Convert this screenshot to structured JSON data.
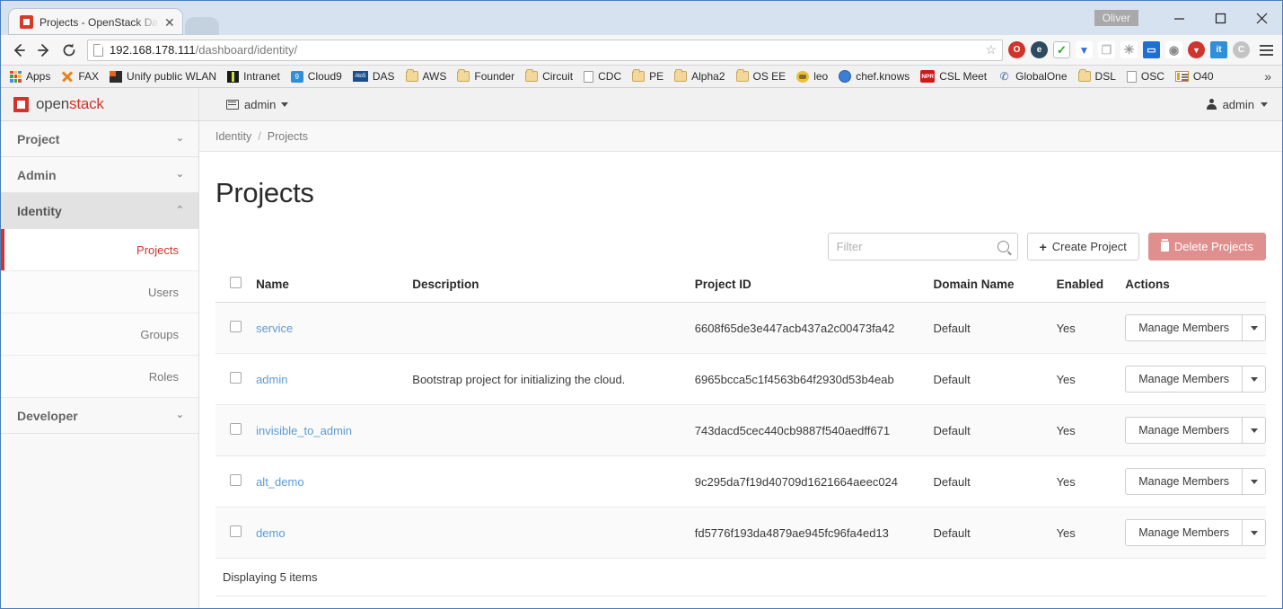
{
  "browser": {
    "tab": {
      "title": "Projects - OpenStack Dash",
      "close_label": "✕",
      "favicon": "openstack-favicon"
    },
    "window": {
      "user_badge": "Oliver",
      "minimize_label": "minimize",
      "maximize_label": "maximize",
      "close_label": "close"
    },
    "nav": {
      "back_label": "←",
      "forward_label": "→",
      "reload_label": "↻",
      "url_host": "192.168.178.111",
      "url_path": "/dashboard/identity/",
      "star_label": "☆",
      "menu_label": "menu"
    },
    "extensions": [
      {
        "name": "opera-icon",
        "glyph": "O",
        "bg": "#d0342c",
        "fg": "#ffffff"
      },
      {
        "name": "edge-icon",
        "glyph": "e",
        "bg": "#2d4a5e",
        "fg": "#ffffff"
      },
      {
        "name": "checkmark-icon",
        "glyph": "✓",
        "bg": "#ffffff",
        "fg": "#2aa62a"
      },
      {
        "name": "diamond-icon",
        "glyph": "▼",
        "bg": "#ffffff",
        "fg": "#3a6fd8"
      },
      {
        "name": "copy-pages-icon",
        "glyph": "❐",
        "bg": "#ffffff",
        "fg": "#b8b8b8"
      },
      {
        "name": "globe-icon",
        "glyph": "●",
        "bg": "#ffffff",
        "fg": "#9a9a9a"
      },
      {
        "name": "window-icon",
        "glyph": "▭",
        "bg": "#1f6fd0",
        "fg": "#ffffff"
      },
      {
        "name": "film-reel-icon",
        "glyph": "◉",
        "bg": "#ffffff",
        "fg": "#8a8a8a"
      },
      {
        "name": "download-icon",
        "glyph": "▼",
        "bg": "#d0342c",
        "fg": "#ffffff"
      },
      {
        "name": "it-icon",
        "glyph": "it",
        "bg": "#2f8fd8",
        "fg": "#ffffff"
      },
      {
        "name": "copy-c-icon",
        "glyph": "C",
        "bg": "#c4c4c4",
        "fg": "#ffffff"
      }
    ],
    "bookmarks": [
      {
        "label": "Apps",
        "icon": "apps-grid-icon"
      },
      {
        "label": "FAX",
        "icon": "fax-x-icon"
      },
      {
        "label": "Unify public WLAN",
        "icon": "unify-icon"
      },
      {
        "label": "Intranet",
        "icon": "intranet-icon"
      },
      {
        "label": "Cloud9",
        "icon": "cloud9-icon"
      },
      {
        "label": "DAS",
        "icon": "das-icon"
      },
      {
        "label": "AWS",
        "icon": "folder-icon"
      },
      {
        "label": "Founder",
        "icon": "folder-icon"
      },
      {
        "label": "Circuit",
        "icon": "folder-icon"
      },
      {
        "label": "CDC",
        "icon": "doc-icon"
      },
      {
        "label": "PE",
        "icon": "folder-icon"
      },
      {
        "label": "Alpha2",
        "icon": "folder-icon"
      },
      {
        "label": "OS EE",
        "icon": "folder-icon"
      },
      {
        "label": "leo",
        "icon": "leo-icon"
      },
      {
        "label": "chef.knows",
        "icon": "chef-icon"
      },
      {
        "label": "CSL Meet",
        "icon": "npr-icon"
      },
      {
        "label": "GlobalOne",
        "icon": "globalone-icon"
      },
      {
        "label": "DSL",
        "icon": "folder-icon"
      },
      {
        "label": "OSC",
        "icon": "doc-icon"
      },
      {
        "label": "O40",
        "icon": "o40-icon"
      }
    ],
    "bookmarks_overflow_label": "»"
  },
  "dashboard": {
    "brand": {
      "word1": "open",
      "word2": "stack",
      "logo": "openstack-logo-icon"
    },
    "context_switcher": {
      "label": "admin",
      "icon": "grid-icon"
    },
    "user_menu": {
      "label": "admin",
      "icon": "person-icon"
    }
  },
  "sidebar": {
    "groups": [
      {
        "label": "Project",
        "chevron": "⌄",
        "state": "collapsed"
      },
      {
        "label": "Admin",
        "chevron": "⌄",
        "state": "collapsed"
      },
      {
        "label": "Identity",
        "chevron": "⌃",
        "state": "expanded"
      }
    ],
    "identity_items": [
      {
        "label": "Projects",
        "current": true
      },
      {
        "label": "Users",
        "current": false
      },
      {
        "label": "Groups",
        "current": false
      },
      {
        "label": "Roles",
        "current": false
      }
    ],
    "developer_group": {
      "label": "Developer",
      "chevron": "⌄",
      "state": "collapsed"
    }
  },
  "breadcrumb": {
    "root": "Identity",
    "separator": "/",
    "current": "Projects"
  },
  "page": {
    "title": "Projects",
    "filter_placeholder": "Filter",
    "filter_value": "",
    "create_button": "Create Project",
    "create_button_icon": "plus-icon",
    "delete_button": "Delete Projects",
    "delete_button_icon": "trash-icon",
    "footer_text": "Displaying 5 items",
    "accent_color": "#d0342c",
    "link_color": "#5b9bd5",
    "danger_color": "#e08f8f"
  },
  "table": {
    "columns": [
      "",
      "Name",
      "Description",
      "Project ID",
      "Domain Name",
      "Enabled",
      "Actions"
    ],
    "action_label": "Manage Members",
    "rows": [
      {
        "name": "service",
        "description": "",
        "project_id": "6608f65de3e447acb437a2c00473fa42",
        "domain": "Default",
        "enabled": "Yes"
      },
      {
        "name": "admin",
        "description": "Bootstrap project for initializing the cloud.",
        "project_id": "6965bcca5c1f4563b64f2930d53b4eab",
        "domain": "Default",
        "enabled": "Yes"
      },
      {
        "name": "invisible_to_admin",
        "description": "",
        "project_id": "743dacd5cec440cb9887f540aedff671",
        "domain": "Default",
        "enabled": "Yes"
      },
      {
        "name": "alt_demo",
        "description": "",
        "project_id": "9c295da7f19d40709d1621664aeec024",
        "domain": "Default",
        "enabled": "Yes"
      },
      {
        "name": "demo",
        "description": "",
        "project_id": "fd5776f193da4879ae945fc96fa4ed13",
        "domain": "Default",
        "enabled": "Yes"
      }
    ]
  }
}
